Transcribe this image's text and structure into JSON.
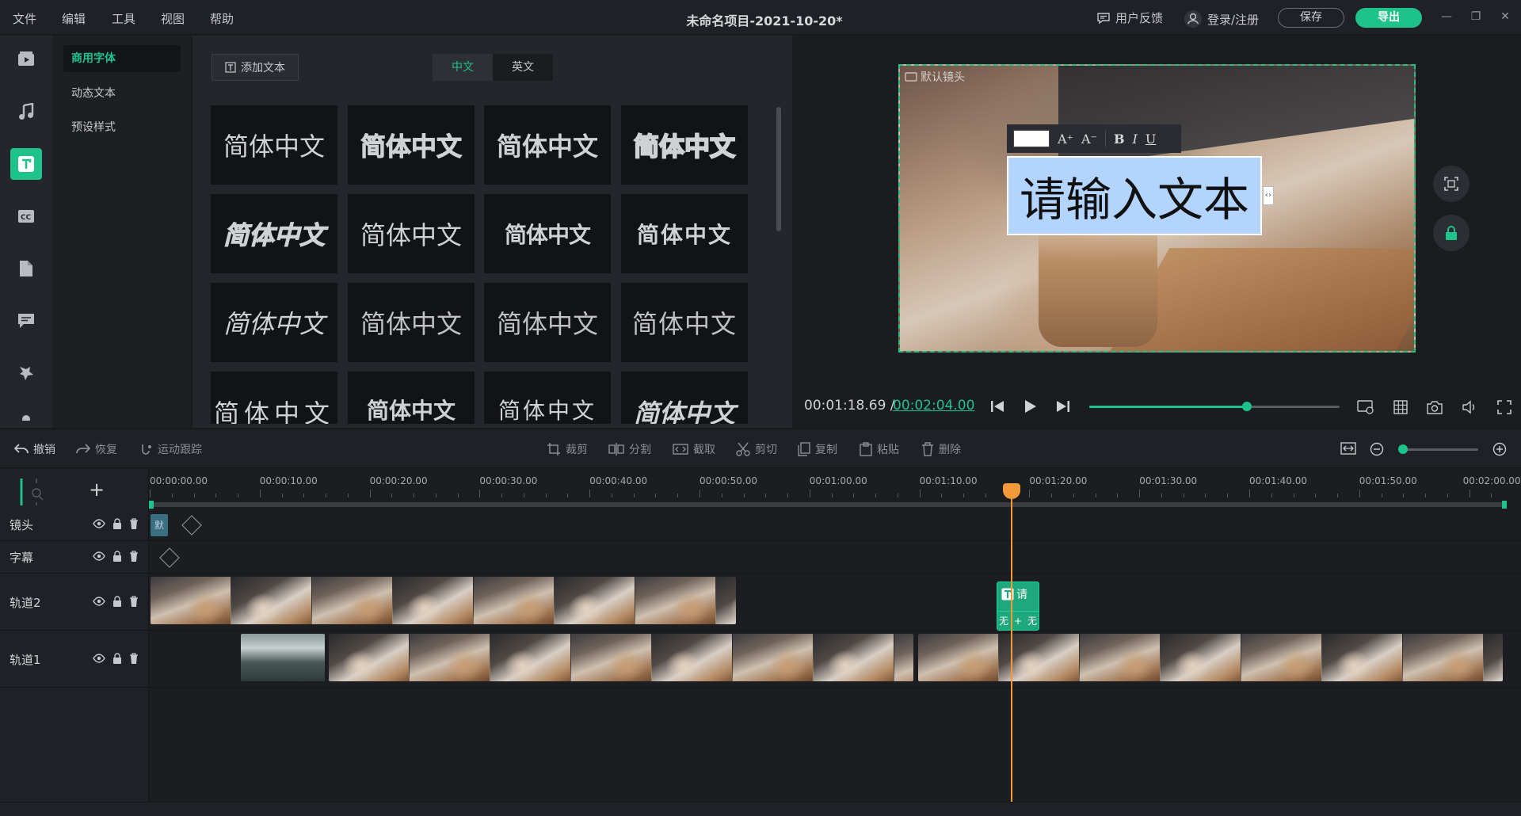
{
  "menu": {
    "file": "文件",
    "edit": "编辑",
    "tools": "工具",
    "view": "视图",
    "help": "帮助"
  },
  "title": "未命名项目-2021-10-20*",
  "header": {
    "feedback": "用户反馈",
    "login": "登录/注册",
    "save": "保存",
    "export": "导出"
  },
  "categories": {
    "commercial": "商用字体",
    "dynamic": "动态文本",
    "preset": "预设样式"
  },
  "gallery": {
    "add_text": "添加文本",
    "tab_cn": "中文",
    "tab_en": "英文",
    "tile_text": "简体中文"
  },
  "preview": {
    "canvas_label": "默认镜头",
    "text_content": "请输入文本",
    "toolbar": {
      "increase": "A⁺",
      "decrease": "A⁻",
      "bold": "B",
      "italic": "I",
      "underline": "U"
    },
    "time_current": "00:01:18.69 /",
    "time_total": "00:02:04.00",
    "progress": 0.63
  },
  "edit_toolbar": {
    "undo": "撤销",
    "redo": "恢复",
    "motion": "运动跟踪",
    "crop": "裁剪",
    "split": "分割",
    "trim": "截取",
    "cut": "剪切",
    "copy": "复制",
    "paste": "粘贴",
    "delete": "删除",
    "zoom": 0.05
  },
  "timeline": {
    "ticks": [
      "00:00:00.00",
      "00:00:10.00",
      "00:00:20.00",
      "00:00:30.00",
      "00:00:40.00",
      "00:00:50.00",
      "00:01:00.00",
      "00:01:10.00",
      "00:01:20.00",
      "00:01:30.00",
      "00:01:40.00",
      "00:01:50.00",
      "00:02:00.00"
    ],
    "tracks": {
      "lens": "镜头",
      "subtitle": "字幕",
      "track2": "轨道2",
      "track1": "轨道1"
    },
    "lens_clip_label": "默",
    "text_clip_label": "请",
    "text_clip_in": "无",
    "text_clip_out": "无"
  },
  "colors": {
    "accent": "#1ec28b",
    "playhead": "#f29b38",
    "panel": "#25262b"
  }
}
